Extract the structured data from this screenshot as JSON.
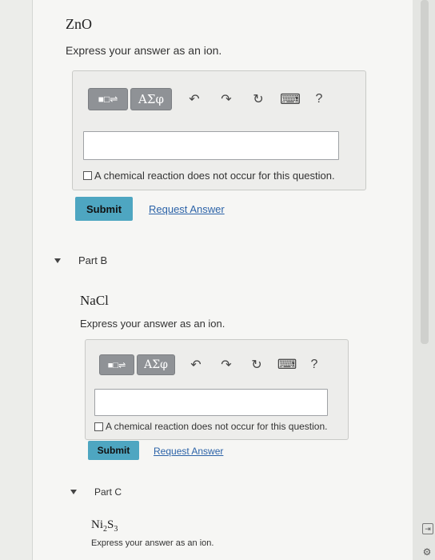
{
  "parts": [
    {
      "formula": "ZnO",
      "prompt": "Express your answer as an ion.",
      "toolbar": {
        "templates": "■□⇌",
        "greek": "ΑΣφ",
        "undo": "↶",
        "redo": "↷",
        "reset": "↻",
        "keyboard": "⌨",
        "help": "?"
      },
      "answer_value": "",
      "no_reaction_label": "A chemical reaction does not occur for this question.",
      "submit_label": "Submit",
      "request_label": "Request Answer"
    },
    {
      "part_label": "Part B",
      "formula": "NaCl",
      "prompt": "Express your answer as an ion.",
      "toolbar": {
        "templates": "■□⇌",
        "greek": "ΑΣφ",
        "undo": "↶",
        "redo": "↷",
        "reset": "↻",
        "keyboard": "⌨",
        "help": "?"
      },
      "answer_value": "",
      "no_reaction_label": "A chemical reaction does not occur for this question.",
      "submit_label": "Submit",
      "request_label": "Request Answer"
    },
    {
      "part_label": "Part C",
      "formula_base": "Ni",
      "formula_sub1": "2",
      "formula_mid": "S",
      "formula_sub2": "3",
      "prompt": "Express your answer as an ion."
    }
  ],
  "side_icons": {
    "exit": "⇥",
    "settings": "⚙"
  }
}
